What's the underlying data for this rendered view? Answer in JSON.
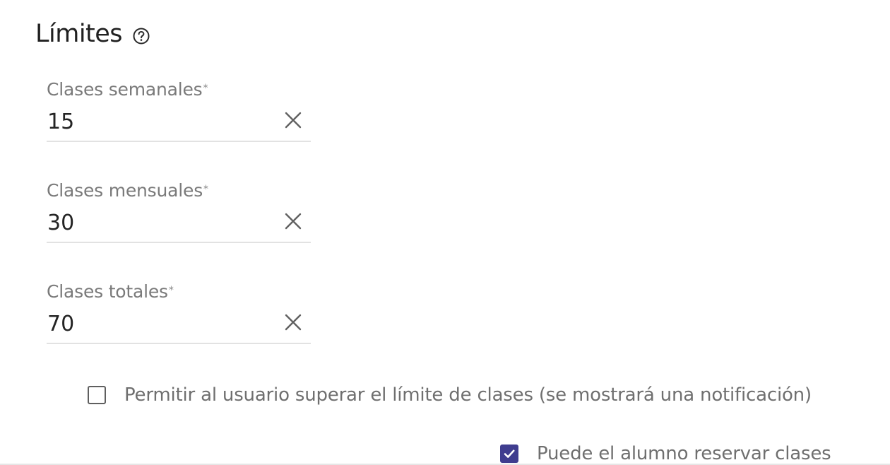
{
  "section": {
    "title": "Límites",
    "help_icon": "help-circle-icon"
  },
  "fields": [
    {
      "label": "Clases semanales",
      "required_mark": "*",
      "value": "15",
      "clear_icon": "close-icon"
    },
    {
      "label": "Clases mensuales",
      "required_mark": "*",
      "value": "30",
      "clear_icon": "close-icon"
    },
    {
      "label": "Clases totales",
      "required_mark": "*",
      "value": "70",
      "clear_icon": "close-icon"
    }
  ],
  "checkboxes": {
    "allow_exceed": {
      "label": "Permitir al usuario superar el límite de clases (se mostrará una notificación)",
      "checked": false
    },
    "can_book": {
      "label": "Puede el alumno reservar clases",
      "checked": true
    }
  },
  "colors": {
    "accent": "#3f3d8f",
    "label": "#7a7a7a",
    "value": "#242424",
    "underline": "#e2e2e2"
  }
}
